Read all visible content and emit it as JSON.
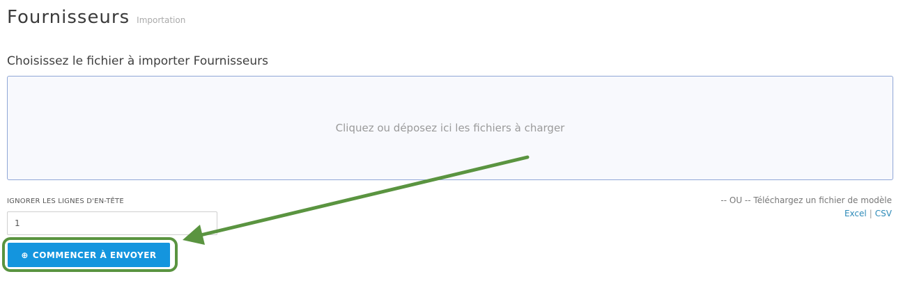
{
  "header": {
    "title": "Fournisseurs",
    "subtitle": "Importation"
  },
  "upload": {
    "section_title": "Choisissez le fichier à importer Fournisseurs",
    "dropzone_text": "Cliquez ou déposez ici les fichiers à charger"
  },
  "options": {
    "ignore_label": "IGNORER LES LIGNES D'EN-TÊTE",
    "ignore_value": "1"
  },
  "template": {
    "text": "-- OU -- Téléchargez un fichier de modèle",
    "excel_label": "Excel",
    "separator": "|",
    "csv_label": "CSV"
  },
  "actions": {
    "start_label": "COMMENCER À ENVOYER",
    "start_icon": "play-circle-icon"
  },
  "annotation": {
    "highlight_color": "#5a9440",
    "arrow_color": "#5a9440"
  }
}
